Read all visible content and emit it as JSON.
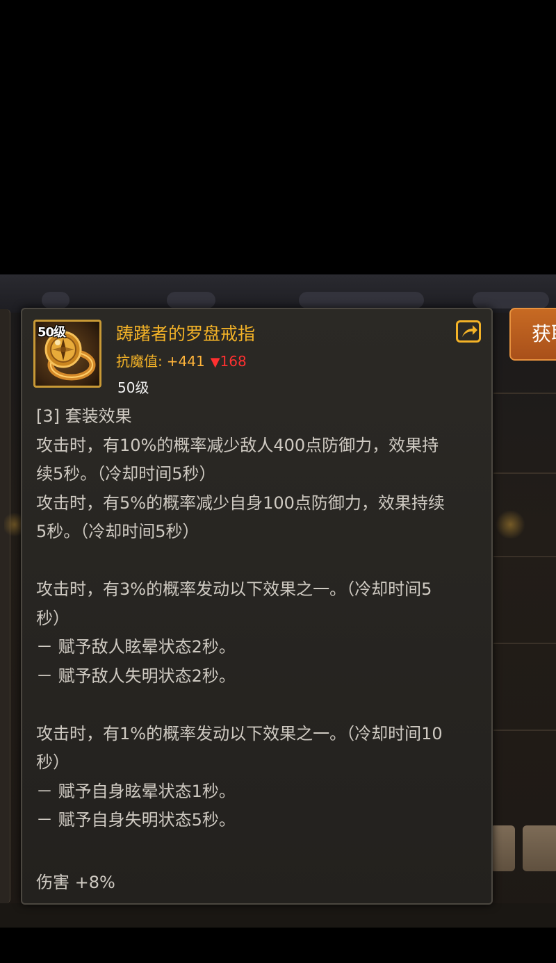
{
  "get_button": {
    "label": "获取"
  },
  "item": {
    "icon": "compass-ring-icon",
    "icon_level_badge": "50级",
    "name": "踌躇者的罗盘戒指",
    "stat": {
      "label": "抗魔值:",
      "value": "+441",
      "change_arrow": "▼",
      "change_value": "168"
    },
    "level": "50级",
    "share_icon": "share-icon"
  },
  "description": {
    "set_title": "[3] 套装效果",
    "lines": [
      "攻击时，有10%的概率减少敌人400点防御力，效果持",
      "续5秒。（冷却时间5秒）",
      "攻击时，有5%的概率减少自身100点防御力，效果持续",
      "5秒。（冷却时间5秒）",
      "",
      "攻击时，有3%的概率发动以下效果之一。（冷却时间5",
      "秒）",
      "－ 赋予敌人眩晕状态2秒。",
      "－ 赋予敌人失明状态2秒。",
      "",
      "攻击时，有1%的概率发动以下效果之一。（冷却时间10",
      "秒）",
      "－ 赋予自身眩晕状态1秒。",
      "－ 赋予自身失明状态5秒。"
    ],
    "damage": "伤害 +8%"
  },
  "colors": {
    "title_gold": "#f3b227",
    "negative_red": "#ff3030",
    "body_text": "#cfcac2",
    "panel_bg": "#2b2925",
    "button_orange": "#c76a23"
  }
}
